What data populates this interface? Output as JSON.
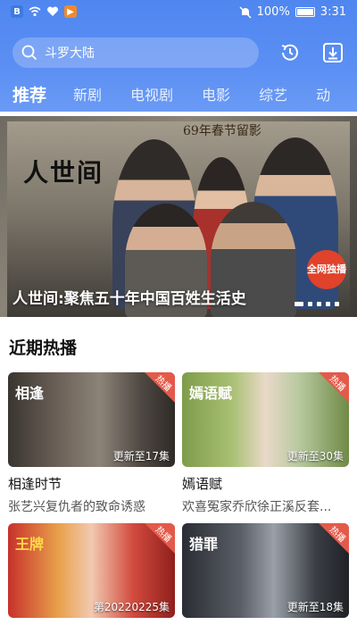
{
  "statusbar": {
    "battery": "100%",
    "time": "3:31"
  },
  "search": {
    "query": "斗罗大陆"
  },
  "tabs": [
    "推荐",
    "新剧",
    "电视剧",
    "电影",
    "综艺",
    "动"
  ],
  "banner": {
    "caption": "人世间:聚焦五十年中国百姓生活史",
    "logo_text": "人世间",
    "tagline": "69年春节留影",
    "badge": "全网独播"
  },
  "section": {
    "title": "近期热播"
  },
  "cards": [
    {
      "title": "相逢时节",
      "subtitle": "张艺兴复仇者的致命诱惑",
      "episode": "更新至17集",
      "tag": "热播"
    },
    {
      "title": "嫣语赋",
      "subtitle": "欢喜冤家乔欣徐正溪反套...",
      "episode": "更新至30集",
      "tag": "热播"
    },
    {
      "title": "",
      "subtitle": "",
      "episode": "第20220225集",
      "tag": "热播"
    },
    {
      "title": "",
      "subtitle": "",
      "episode": "更新至18集",
      "tag": "热播"
    }
  ],
  "colors": {
    "header_blue": "#5b8ff3",
    "tag_red": "#e35a4a"
  }
}
